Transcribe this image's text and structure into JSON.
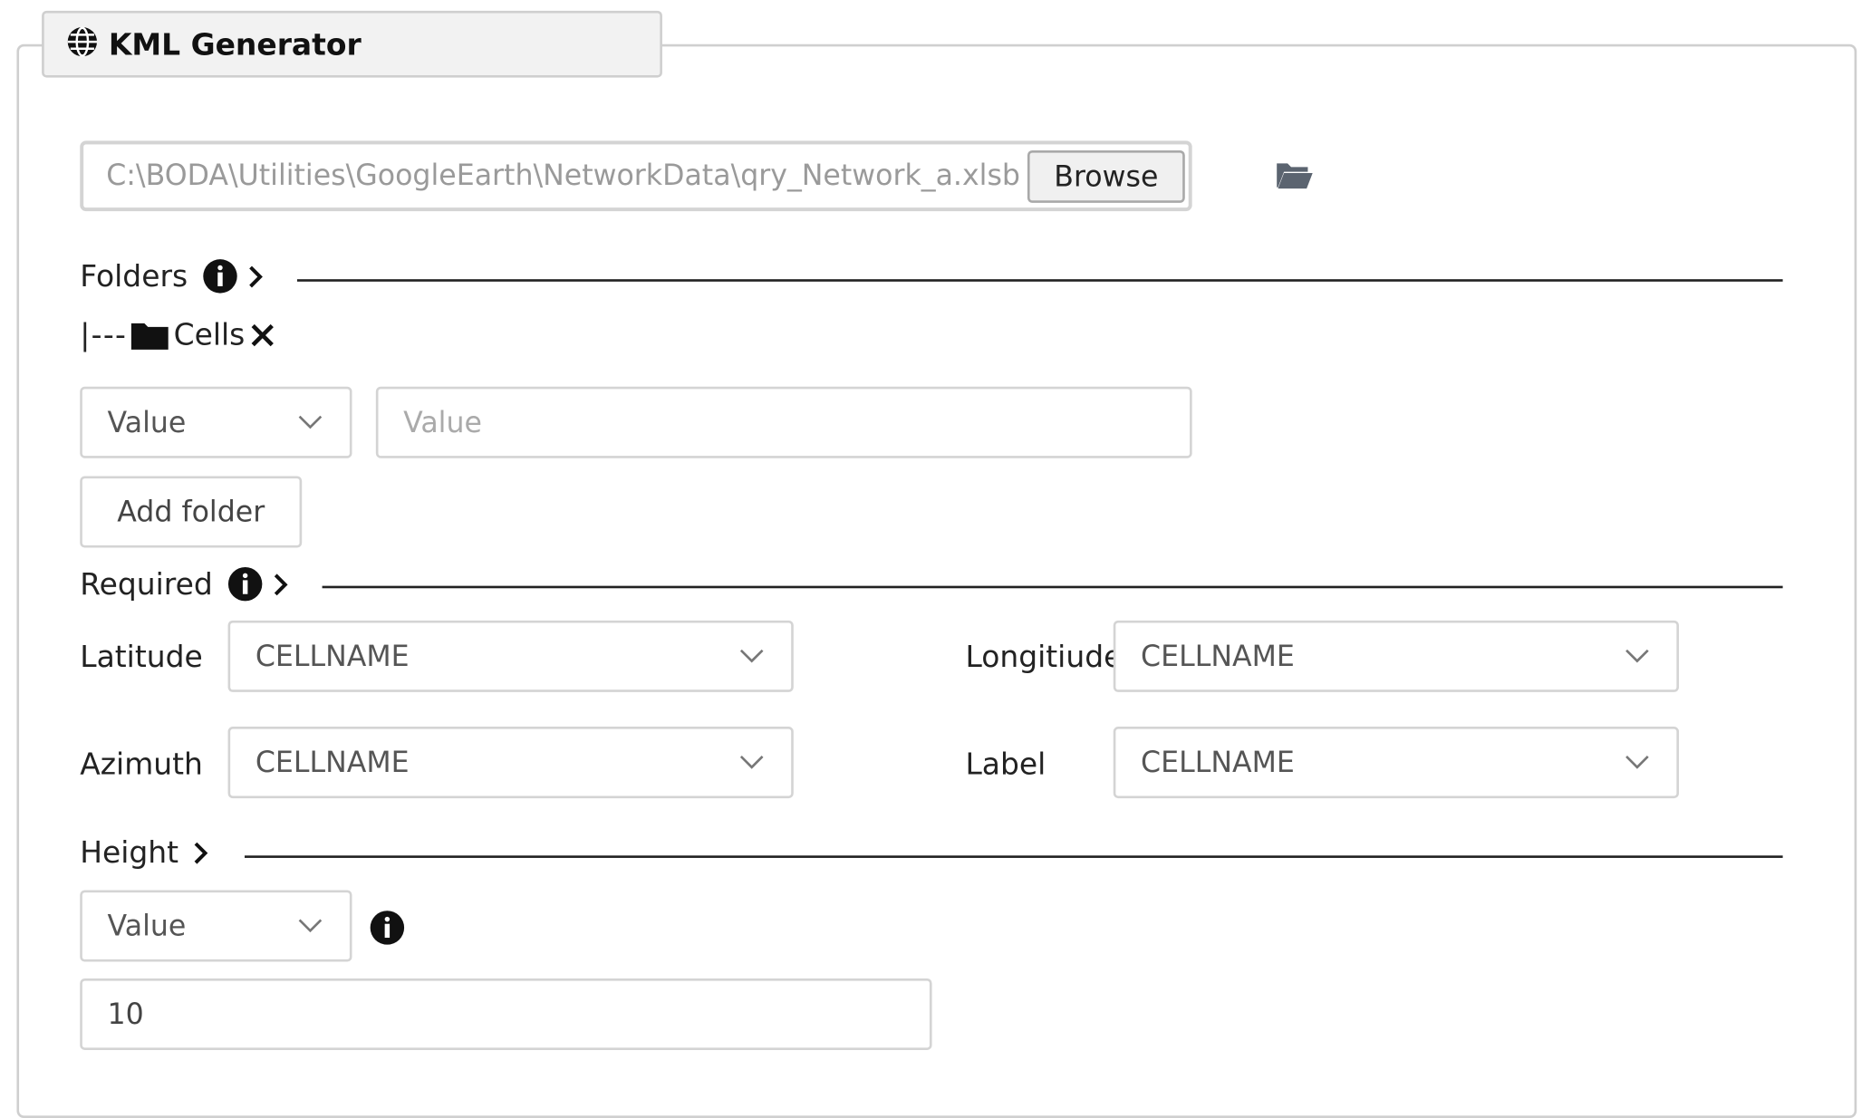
{
  "tab": {
    "title": "KML Generator",
    "icon": "globe-icon"
  },
  "file": {
    "path": "C:\\BODA\\Utilities\\GoogleEarth\\NetworkData\\qry_Network_a.xlsb",
    "browse_label": "Browse",
    "open_icon": "folder-open-icon"
  },
  "folders": {
    "label": "Folders",
    "tree": [
      {
        "prefix": "|---",
        "name": "Cells"
      }
    ],
    "type_select": "Value",
    "value_placeholder": "Value",
    "add_label": "Add folder"
  },
  "required": {
    "label": "Required",
    "fields": {
      "latitude": {
        "label": "Latitude",
        "value": "CELLNAME"
      },
      "longitude": {
        "label": "Longitiude",
        "value": "CELLNAME"
      },
      "azimuth": {
        "label": "Azimuth",
        "value": "CELLNAME"
      },
      "label": {
        "label": "Label",
        "value": "CELLNAME"
      }
    }
  },
  "height": {
    "label": "Height",
    "type_select": "Value",
    "value": "10"
  },
  "colors": {
    "border": "#d4d4d4",
    "tab_bg": "#f2f2f2",
    "text": "#222222",
    "muted_text": "#9a9a9a"
  }
}
